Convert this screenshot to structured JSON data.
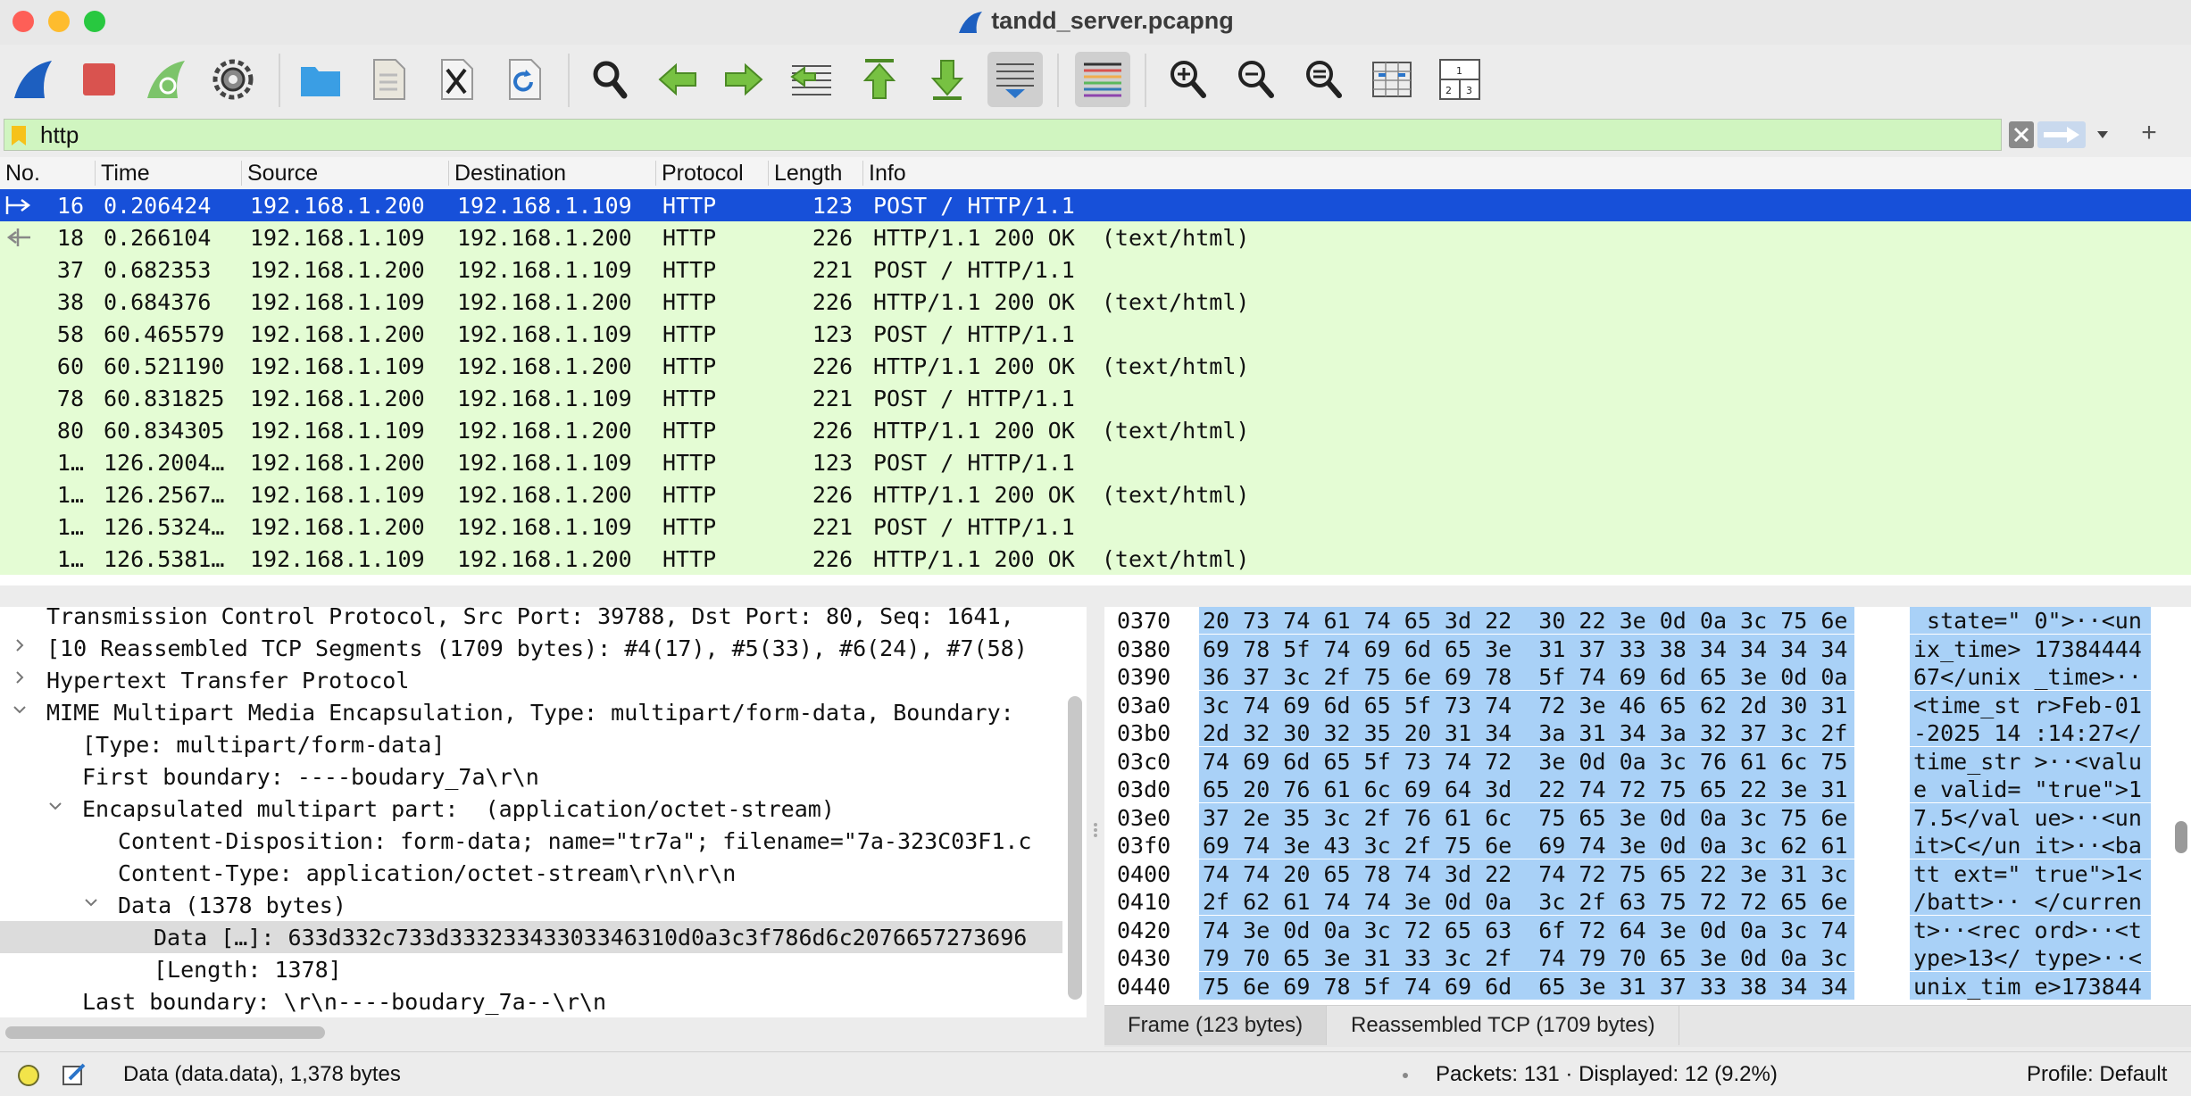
{
  "window": {
    "title": "tandd_server.pcapng"
  },
  "toolbar": {
    "buttons": [
      "start-capture",
      "stop-capture",
      "restart-capture",
      "capture-options",
      "open-file",
      "save-file",
      "close-file",
      "reload-file",
      "find-packet",
      "go-back",
      "go-forward",
      "go-to-packet",
      "go-first",
      "go-last",
      "auto-scroll",
      "colorize",
      "zoom-in",
      "zoom-out",
      "zoom-normal",
      "resize-columns",
      "layout"
    ]
  },
  "filter": {
    "value": "http",
    "add_label": "+"
  },
  "packet_list": {
    "columns": [
      "No.",
      "Time",
      "Source",
      "Destination",
      "Protocol",
      "Length",
      "Info"
    ],
    "rows": [
      {
        "no": "16",
        "time": "0.206424",
        "src": "192.168.1.200",
        "dst": "192.168.1.109",
        "proto": "HTTP",
        "len": "123",
        "info": "POST / HTTP/1.1",
        "selected": true
      },
      {
        "no": "18",
        "time": "0.266104",
        "src": "192.168.1.109",
        "dst": "192.168.1.200",
        "proto": "HTTP",
        "len": "226",
        "info": "HTTP/1.1 200 OK  (text/html)"
      },
      {
        "no": "37",
        "time": "0.682353",
        "src": "192.168.1.200",
        "dst": "192.168.1.109",
        "proto": "HTTP",
        "len": "221",
        "info": "POST / HTTP/1.1"
      },
      {
        "no": "38",
        "time": "0.684376",
        "src": "192.168.1.109",
        "dst": "192.168.1.200",
        "proto": "HTTP",
        "len": "226",
        "info": "HTTP/1.1 200 OK  (text/html)"
      },
      {
        "no": "58",
        "time": "60.465579",
        "src": "192.168.1.200",
        "dst": "192.168.1.109",
        "proto": "HTTP",
        "len": "123",
        "info": "POST / HTTP/1.1"
      },
      {
        "no": "60",
        "time": "60.521190",
        "src": "192.168.1.109",
        "dst": "192.168.1.200",
        "proto": "HTTP",
        "len": "226",
        "info": "HTTP/1.1 200 OK  (text/html)"
      },
      {
        "no": "78",
        "time": "60.831825",
        "src": "192.168.1.200",
        "dst": "192.168.1.109",
        "proto": "HTTP",
        "len": "221",
        "info": "POST / HTTP/1.1"
      },
      {
        "no": "80",
        "time": "60.834305",
        "src": "192.168.1.109",
        "dst": "192.168.1.200",
        "proto": "HTTP",
        "len": "226",
        "info": "HTTP/1.1 200 OK  (text/html)"
      },
      {
        "no": "1…",
        "time": "126.2004…",
        "src": "192.168.1.200",
        "dst": "192.168.1.109",
        "proto": "HTTP",
        "len": "123",
        "info": "POST / HTTP/1.1"
      },
      {
        "no": "1…",
        "time": "126.2567…",
        "src": "192.168.1.109",
        "dst": "192.168.1.200",
        "proto": "HTTP",
        "len": "226",
        "info": "HTTP/1.1 200 OK  (text/html)"
      },
      {
        "no": "1…",
        "time": "126.5324…",
        "src": "192.168.1.200",
        "dst": "192.168.1.109",
        "proto": "HTTP",
        "len": "221",
        "info": "POST / HTTP/1.1"
      },
      {
        "no": "1…",
        "time": "126.5381…",
        "src": "192.168.1.109",
        "dst": "192.168.1.200",
        "proto": "HTTP",
        "len": "226",
        "info": "HTTP/1.1 200 OK  (text/html)"
      }
    ]
  },
  "details": {
    "lines": [
      {
        "twisty": "",
        "text": "Transmission Control Protocol, Src Port: 39788, Dst Port: 80, Seq: 1641,"
      },
      {
        "twisty": ">",
        "text": "[10 Reassembled TCP Segments (1709 bytes): #4(17), #5(33), #6(24), #7(58)"
      },
      {
        "twisty": ">",
        "text": "Hypertext Transfer Protocol"
      },
      {
        "twisty": "v",
        "text": "MIME Multipart Media Encapsulation, Type: multipart/form-data, Boundary:"
      },
      {
        "twisty": "",
        "text": "[Type: multipart/form-data]"
      },
      {
        "twisty": "",
        "text": "First boundary: ----boudary_7a\\r\\n"
      },
      {
        "twisty": "v",
        "text": "Encapsulated multipart part:  (application/octet-stream)"
      },
      {
        "twisty": "",
        "text": "Content-Disposition: form-data; name=\"tr7a\"; filename=\"7a-323C03F1.c"
      },
      {
        "twisty": "",
        "text": "Content-Type: application/octet-stream\\r\\n\\r\\n"
      },
      {
        "twisty": "v",
        "text": "Data (1378 bytes)"
      },
      {
        "twisty": "",
        "text": "Data […]: 633d332c733d33323343303346310d0a3c3f786d6c2076657273696"
      },
      {
        "twisty": "",
        "text": "[Length: 1378]"
      },
      {
        "twisty": "",
        "text": "Last boundary: \\r\\n----boudary_7a--\\r\\n"
      }
    ]
  },
  "bytes": {
    "rows": [
      {
        "off": "0370",
        "hex": "20 73 74 61 74 65 3d 22  30 22 3e 0d 0a 3c 75 6e",
        "ascii": " state=\" 0\">··<un"
      },
      {
        "off": "0380",
        "hex": "69 78 5f 74 69 6d 65 3e  31 37 33 38 34 34 34 34",
        "ascii": "ix_time> 17384444"
      },
      {
        "off": "0390",
        "hex": "36 37 3c 2f 75 6e 69 78  5f 74 69 6d 65 3e 0d 0a",
        "ascii": "67</unix _time>··"
      },
      {
        "off": "03a0",
        "hex": "3c 74 69 6d 65 5f 73 74  72 3e 46 65 62 2d 30 31",
        "ascii": "<time_st r>Feb-01"
      },
      {
        "off": "03b0",
        "hex": "2d 32 30 32 35 20 31 34  3a 31 34 3a 32 37 3c 2f",
        "ascii": "-2025 14 :14:27</"
      },
      {
        "off": "03c0",
        "hex": "74 69 6d 65 5f 73 74 72  3e 0d 0a 3c 76 61 6c 75",
        "ascii": "time_str >··<valu"
      },
      {
        "off": "03d0",
        "hex": "65 20 76 61 6c 69 64 3d  22 74 72 75 65 22 3e 31",
        "ascii": "e valid= \"true\">1"
      },
      {
        "off": "03e0",
        "hex": "37 2e 35 3c 2f 76 61 6c  75 65 3e 0d 0a 3c 75 6e",
        "ascii": "7.5</val ue>··<un"
      },
      {
        "off": "03f0",
        "hex": "69 74 3e 43 3c 2f 75 6e  69 74 3e 0d 0a 3c 62 61",
        "ascii": "it>C</un it>··<ba"
      },
      {
        "off": "0400",
        "hex": "74 74 20 65 78 74 3d 22  74 72 75 65 22 3e 31 3c",
        "ascii": "tt ext=\" true\">1<"
      },
      {
        "off": "0410",
        "hex": "2f 62 61 74 74 3e 0d 0a  3c 2f 63 75 72 72 65 6e",
        "ascii": "/batt>·· </curren"
      },
      {
        "off": "0420",
        "hex": "74 3e 0d 0a 3c 72 65 63  6f 72 64 3e 0d 0a 3c 74",
        "ascii": "t>··<rec ord>··<t"
      },
      {
        "off": "0430",
        "hex": "79 70 65 3e 31 33 3c 2f  74 79 70 65 3e 0d 0a 3c",
        "ascii": "ype>13</ type>··<"
      },
      {
        "off": "0440",
        "hex": "75 6e 69 78 5f 74 69 6d  65 3e 31 37 33 38 34 34",
        "ascii": "unix_tim e>173844"
      }
    ],
    "tabs": [
      "Frame (123 bytes)",
      "Reassembled TCP (1709 bytes)"
    ]
  },
  "status": {
    "field": "Data (data.data), 1,378 bytes",
    "packets": "Packets: 131 · Displayed: 12 (9.2%)",
    "profile": "Profile: Default"
  },
  "colors": {
    "selection": "#1750d9",
    "http_row": "#e4fcd4",
    "filter_ok": "#d0f5c0",
    "byte_highlight": "#a9d1f7"
  }
}
